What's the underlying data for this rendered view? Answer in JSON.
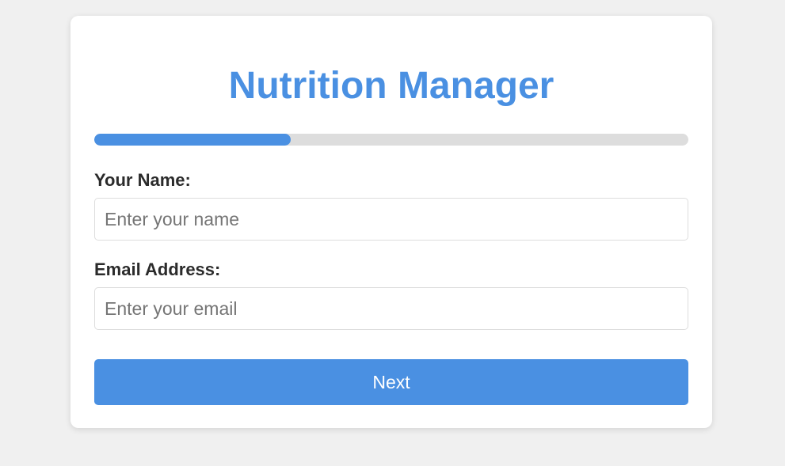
{
  "app": {
    "title": "Nutrition Manager"
  },
  "progress": {
    "fraction": 0.33
  },
  "form": {
    "name": {
      "label": "Your Name:",
      "value": "",
      "placeholder": "Enter your name"
    },
    "email": {
      "label": "Email Address:",
      "value": "",
      "placeholder": "Enter your email"
    },
    "next_label": "Next"
  },
  "colors": {
    "accent": "#4a90e2",
    "background": "#f0f0f0",
    "track": "#dddddd",
    "card": "#ffffff"
  }
}
